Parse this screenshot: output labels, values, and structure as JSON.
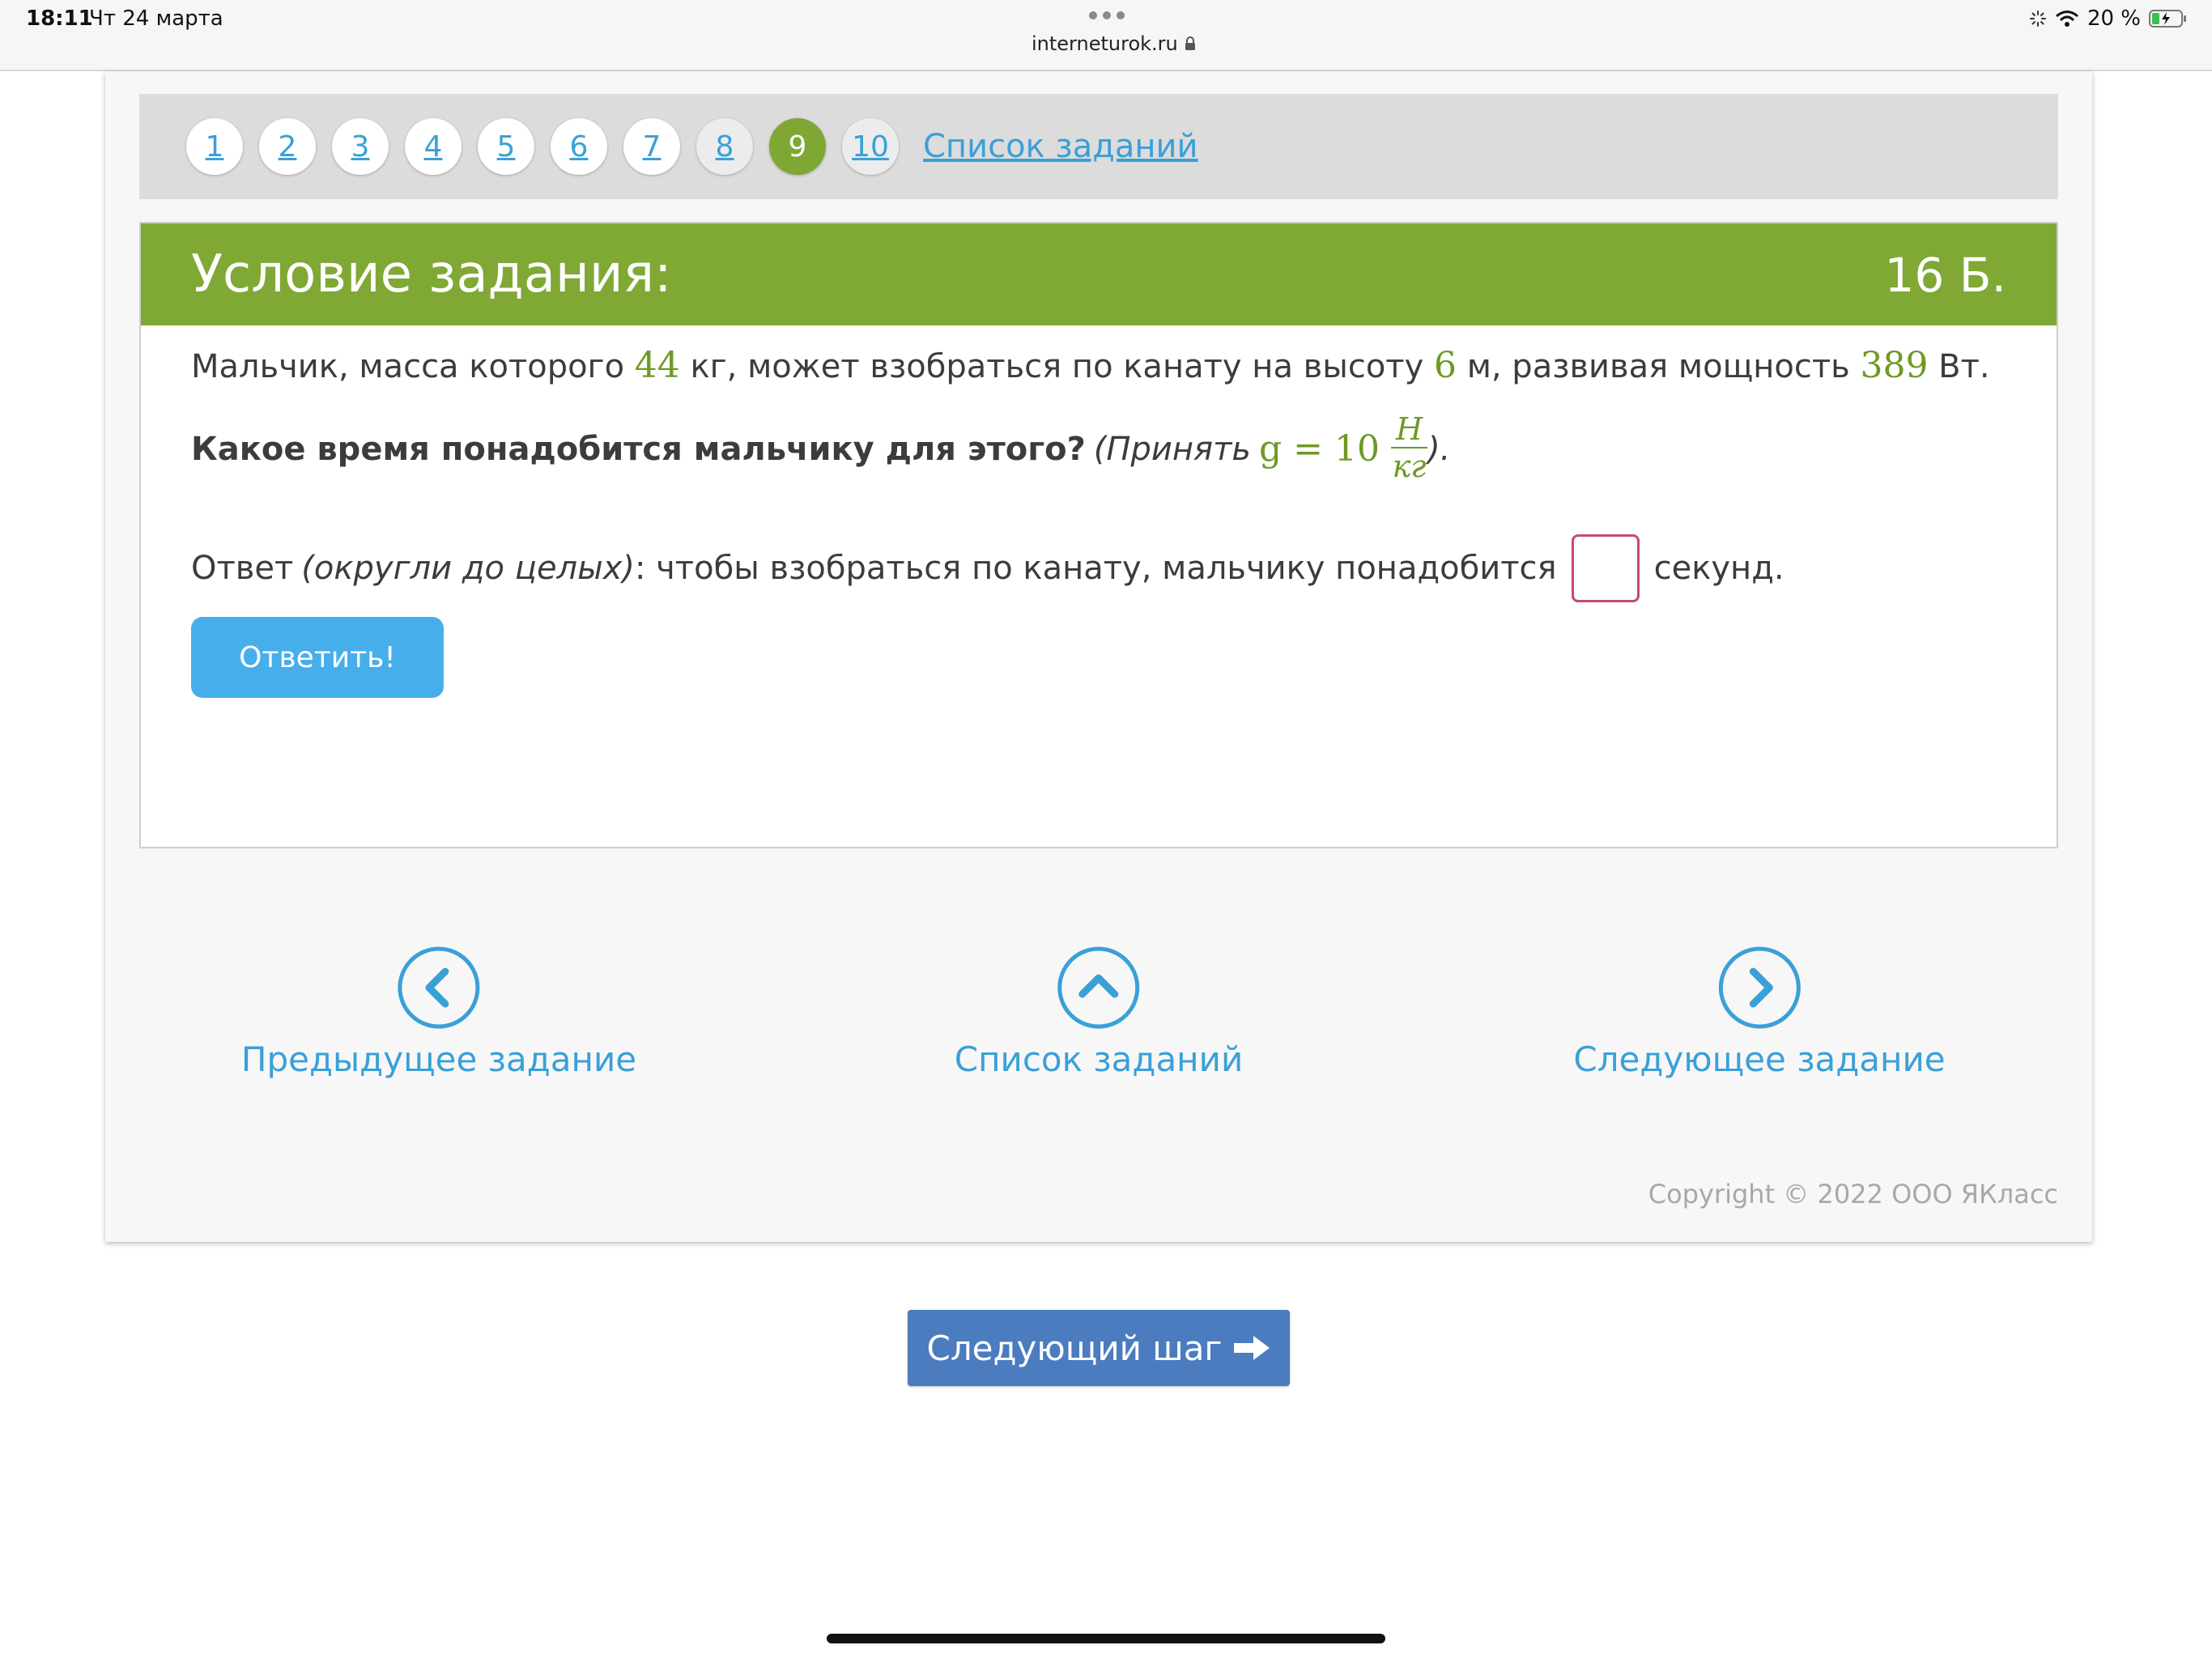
{
  "status_bar": {
    "time": "18:11",
    "date": "Чт 24 марта",
    "url": "interneturok.ru",
    "battery": "20 %"
  },
  "task_nav": {
    "numbers": [
      "1",
      "2",
      "3",
      "4",
      "5",
      "6",
      "7",
      "8",
      "9",
      "10"
    ],
    "current": "9",
    "list_link": "Список заданий"
  },
  "task": {
    "title": "Условие задания:",
    "points": "16 Б.",
    "line1": {
      "t1": "Мальчик, масса которого",
      "mass": "44",
      "t2": "кг, может взобраться по канату на высоту",
      "height": "6",
      "t3": "м, развивая мощность",
      "power": "389",
      "t4": "Вт."
    },
    "line2": {
      "question": "Какое время понадобится мальчику для этого?",
      "note_start": "(Принять",
      "g_formula": "g = 10",
      "unit_num": "Н",
      "unit_den": "кг",
      "note_end": ")."
    },
    "line3": {
      "prefix": "Ответ",
      "hint": "(округли до целых)",
      "text": ": чтобы взобраться по канату, мальчику понадобится",
      "suffix": "секунд."
    },
    "answer_value": "",
    "submit_label": "Ответить!"
  },
  "bottom_nav": {
    "prev": "Предыдущее задание",
    "list": "Список заданий",
    "next": "Следующее задание"
  },
  "copyright": "Copyright © 2022 ООО ЯКласс",
  "next_step_label": "Следующий шаг",
  "colors": {
    "green": "#80a834",
    "blue_link": "#3aa0d8",
    "button_blue": "#47aeec",
    "next_step_blue": "#4a7cbf",
    "input_border": "#c9467a"
  }
}
